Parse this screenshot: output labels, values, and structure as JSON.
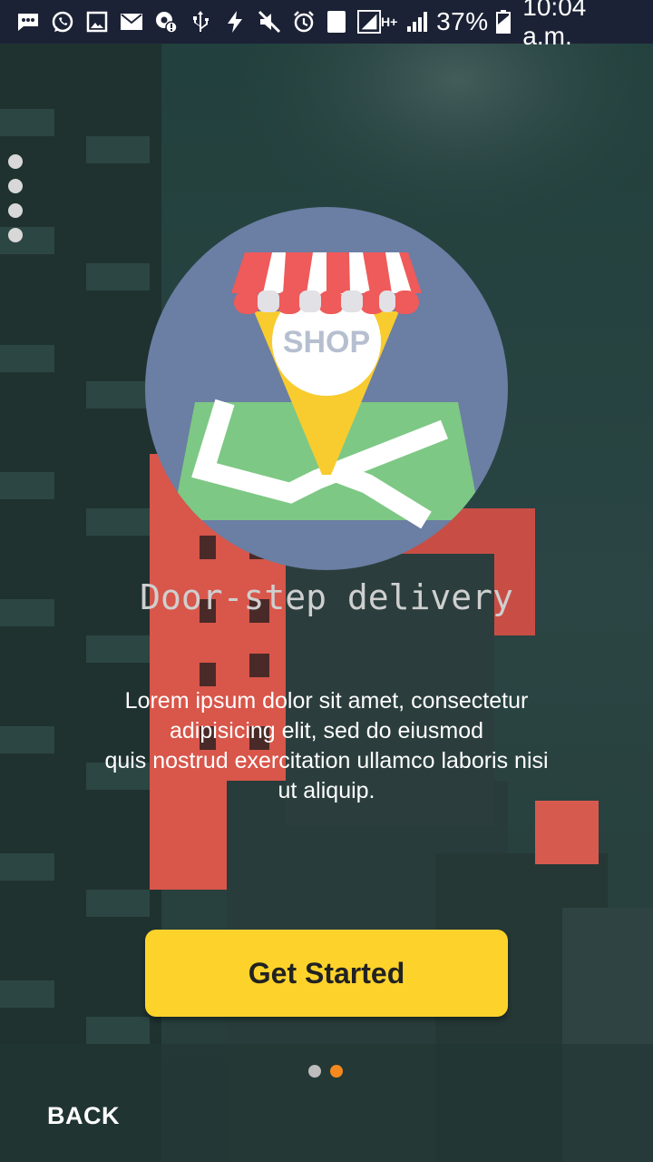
{
  "status_bar": {
    "icons": [
      "message-icon",
      "whatsapp-icon",
      "image-icon",
      "mail-icon",
      "settings-alert-icon",
      "usb-icon",
      "flash-icon",
      "mute-icon",
      "alarm-icon",
      "sim-1-icon",
      "signal-icon",
      "hplus-icon",
      "signal-bars-icon",
      "battery-icon"
    ],
    "sim_label": "1",
    "network_label": "H+",
    "battery": "37%",
    "time": "10:04 a.m."
  },
  "onboarding": {
    "illustration_text": "SHOP",
    "title": "Door-step delivery",
    "description": [
      "Lorem ipsum dolor sit amet, consectetur",
      "adipisicing elit, sed do eiusmod",
      "quis nostrud exercitation ullamco laboris nisi",
      "ut aliquip."
    ],
    "cta_label": "Get Started",
    "back_label": "BACK",
    "page_count": 2,
    "current_page": 2
  },
  "colors": {
    "status_bar": "#1c2236",
    "cta": "#fdd32b",
    "pager_active": "#f5891f",
    "pager_inactive": "#bdbdbd",
    "circle": "#6b7ea3",
    "map_green": "#7dc884",
    "pin_yellow": "#f8cc2f",
    "awning_red": "#ef5a5a"
  }
}
